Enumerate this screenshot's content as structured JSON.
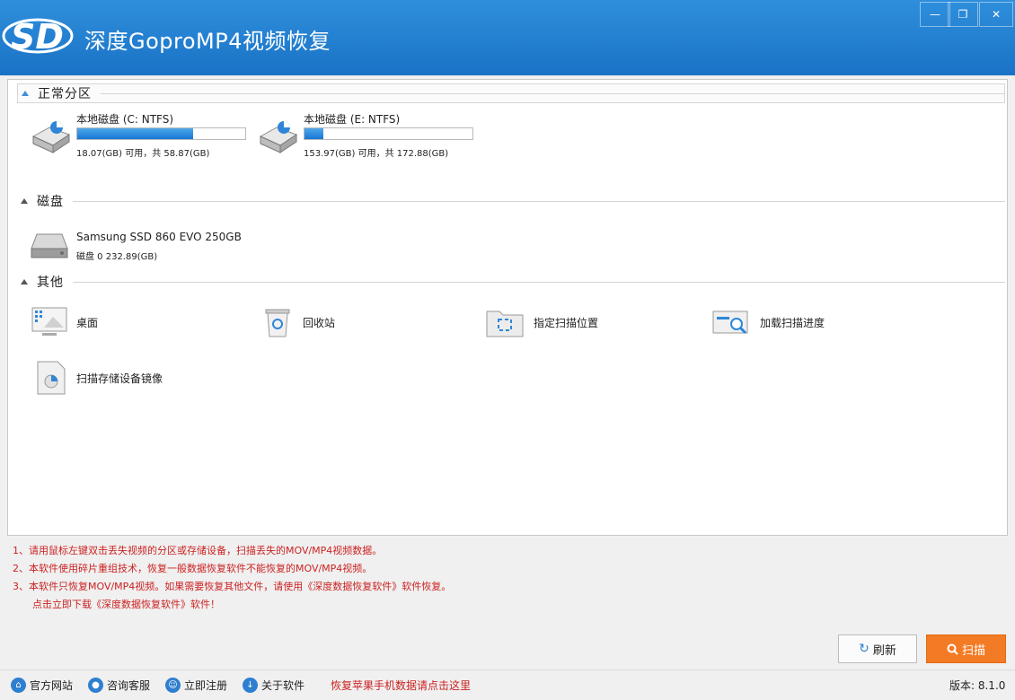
{
  "title": "深度GoproMP4视频恢复",
  "logo_text": "SD",
  "window_controls": {
    "minimize": "—",
    "restore": "❐",
    "close": "✕"
  },
  "sections": {
    "partitions": "正常分区",
    "disks": "磁盘",
    "others": "其他"
  },
  "partitions": [
    {
      "label": "本地磁盘 (C: NTFS)",
      "sub": "18.07(GB) 可用，共 58.87(GB)",
      "used_pct": 69
    },
    {
      "label": "本地磁盘 (E: NTFS)",
      "sub": "153.97(GB) 可用，共 172.88(GB)",
      "used_pct": 11
    }
  ],
  "disk": {
    "label": "Samsung SSD 860 EVO 250GB",
    "sub": "磁盘 0     232.89(GB)"
  },
  "others": {
    "desktop": "桌面",
    "recycle": "回收站",
    "location": "指定扫描位置",
    "load": "加载扫描进度",
    "image": "扫描存储设备镜像"
  },
  "notes": [
    "1、请用鼠标左键双击丢失视频的分区或存储设备，扫描丢失的MOV/MP4视频数据。",
    "2、本软件使用碎片重组技术，恢复一般数据恢复软件不能恢复的MOV/MP4视频。",
    "3、本软件只恢复MOV/MP4视频。如果需要恢复其他文件，请使用《深度数据恢复软件》软件恢复。",
    "点击立即下载《深度数据恢复软件》软件！"
  ],
  "buttons": {
    "refresh": "刷新",
    "scan": "扫描"
  },
  "status": {
    "website": "官方网站",
    "support": "咨询客服",
    "register": "立即注册",
    "about": "关于软件",
    "apple_link": "恢复苹果手机数据请点击这里",
    "version": "版本: 8.1.0"
  },
  "colors": {
    "accent": "#1f7ed0",
    "scan": "#f47b25",
    "notes": "#cc2222"
  }
}
